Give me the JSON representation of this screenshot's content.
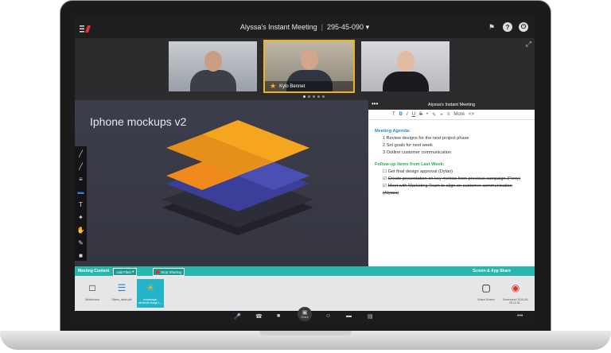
{
  "window": {
    "title": "Alyssa's Instant Meeting",
    "meeting_id": "295-45-090",
    "meeting_id_caret": "▾"
  },
  "titlebar_icons": {
    "flag": "⚑",
    "help": "?",
    "power": "⏻",
    "popout": "⤢"
  },
  "videos": [
    {
      "name": ""
    },
    {
      "name": "Kylo Bennet",
      "presenter_star": "★"
    },
    {
      "name": ""
    }
  ],
  "slide": {
    "title": "Iphone mockups v2"
  },
  "drawing_tools": [
    "╱",
    "╱",
    "≡",
    "▬",
    "T",
    "✦",
    "✋",
    "✎",
    "■"
  ],
  "notes": {
    "header_title": "Alyssa's Instant Meeting",
    "more": "•••",
    "format_buttons": [
      "T",
      "B",
      "I",
      "U",
      "S",
      "•",
      "✎",
      "◒",
      "≡",
      "More",
      "<>"
    ],
    "agenda_heading": "Meeting Agenda:",
    "agenda": [
      "1  Review designs for the next project phase",
      "2  Set goals for next week",
      "3  Outline customer communication"
    ],
    "followup_heading": "Follow-up items from Last Week:",
    "followups": [
      {
        "text": "Get final design approval (Dylan)",
        "done": false
      },
      {
        "text": "Create presentation on key metrics from previous campaign (Perry)",
        "done": true
      },
      {
        "text": "Meet with Marketing Team to align on customer communication (Alyssa)",
        "done": true
      }
    ]
  },
  "content_bar": {
    "meeting_content": "Meeting Content",
    "add_files": "Add Files",
    "stop_sharing": "Stop Sharing",
    "screen_app_share": "Screen & App Share"
  },
  "thumbnails": [
    {
      "label": "Whiteboard",
      "icon": "□"
    },
    {
      "label": "Slides_table.pdf",
      "icon": "☰"
    },
    {
      "label": "knowledge-ultrawide.image-L...",
      "icon": "☀"
    },
    {
      "label": "Share Screen",
      "icon": "▢"
    },
    {
      "label": "Screenshot 2015-06-28 11:16...",
      "icon": "◉"
    }
  ],
  "controls": {
    "mute": "🎤",
    "phone": "☎",
    "camera": "■",
    "share_label": "Share",
    "share_icon": "▣",
    "participants": "☺",
    "chat": "▬",
    "files": "▤",
    "more": "•••"
  }
}
